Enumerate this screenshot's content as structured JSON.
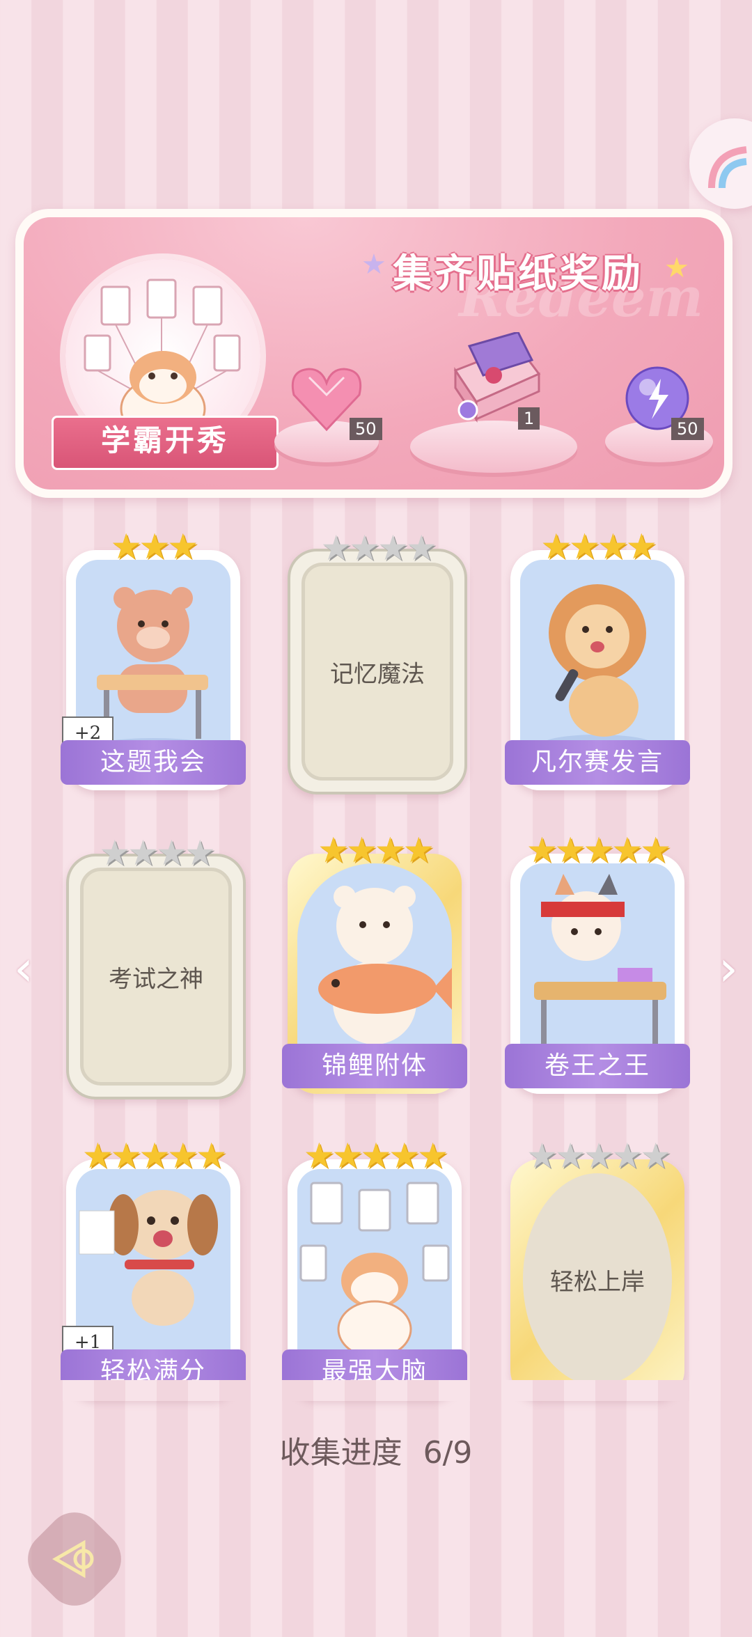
{
  "banner": {
    "title": "集齐贴纸奖励",
    "watermark": "Redeem",
    "collection_name": "学霸开秀",
    "rewards": [
      {
        "icon": "pink-heart-gem-icon",
        "count": "50"
      },
      {
        "icon": "gift-box-icon",
        "count": "1"
      },
      {
        "icon": "purple-energy-orb-icon",
        "count": "50"
      }
    ]
  },
  "stickers": [
    {
      "label": "这题我会",
      "stars": 3,
      "max_stars": 3,
      "state": "collected",
      "extra": "+2",
      "art": "bear-at-desk"
    },
    {
      "label": "记忆魔法",
      "stars": 0,
      "max_stars": 4,
      "state": "locked",
      "art": ""
    },
    {
      "label": "凡尔赛发言",
      "stars": 4,
      "max_stars": 4,
      "state": "collected",
      "art": "lion-microphone"
    },
    {
      "label": "考试之神",
      "stars": 0,
      "max_stars": 4,
      "state": "locked",
      "art": ""
    },
    {
      "label": "锦鲤附体",
      "stars": 4,
      "max_stars": 4,
      "state": "collected-gold",
      "art": "bear-with-koi"
    },
    {
      "label": "卷王之王",
      "stars": 5,
      "max_stars": 5,
      "state": "collected",
      "art": "cat-studying"
    },
    {
      "label": "轻松满分",
      "stars": 5,
      "max_stars": 5,
      "state": "collected",
      "extra": "+1",
      "art": "puppy-full-marks"
    },
    {
      "label": "最强大脑",
      "stars": 5,
      "max_stars": 5,
      "state": "collected",
      "art": "shiba-with-papers"
    },
    {
      "label": "轻松上岸",
      "stars": 0,
      "max_stars": 5,
      "state": "locked-gold",
      "art": ""
    }
  ],
  "progress": {
    "label": "收集进度",
    "value": "6/9"
  },
  "colors": {
    "accent_pink": "#ea6f8d",
    "label_purple": "#9b74d6",
    "star_gold": "#f7c52e"
  }
}
